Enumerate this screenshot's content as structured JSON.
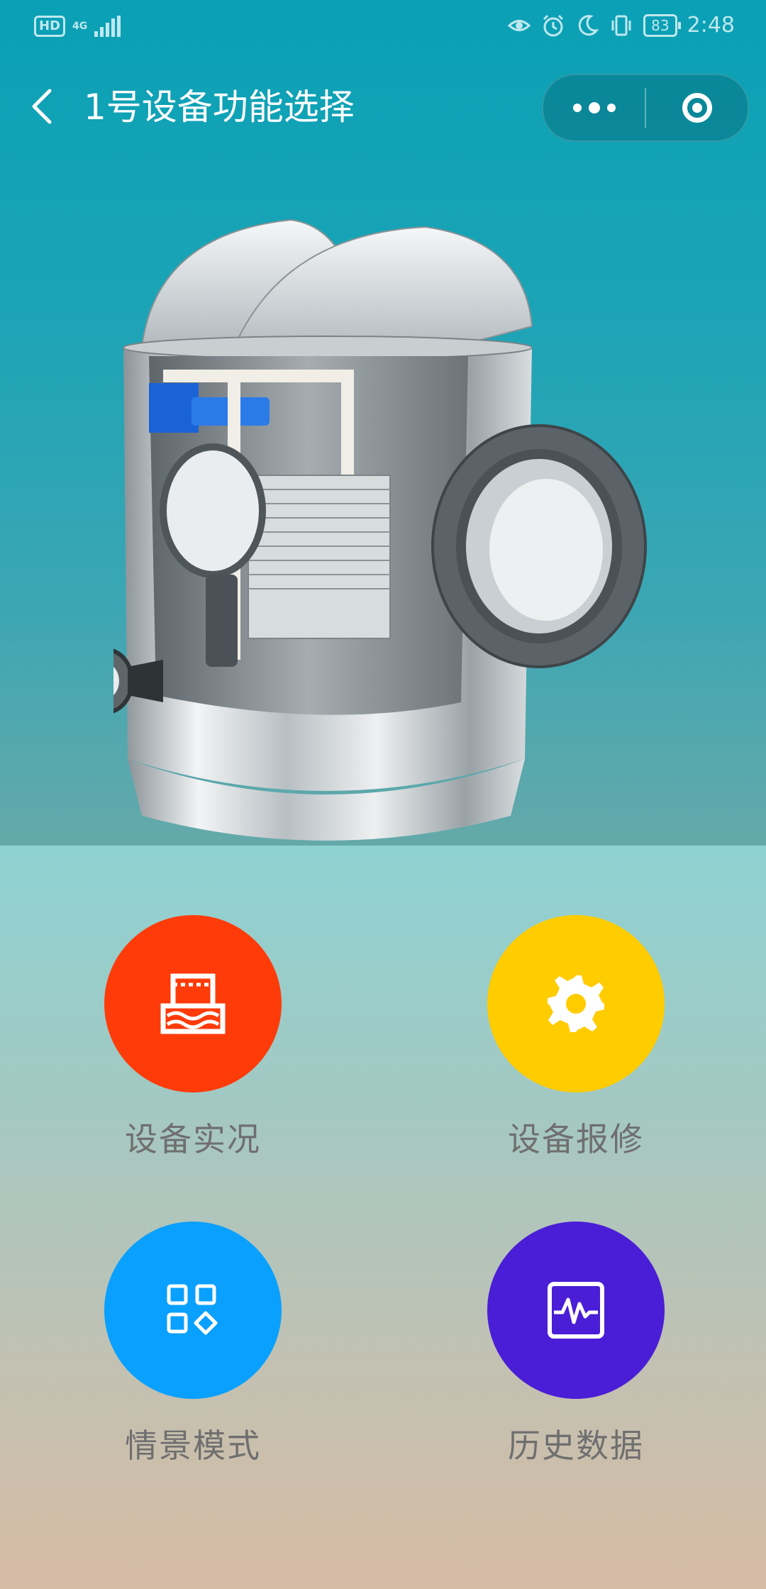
{
  "status_bar": {
    "hd": "HD",
    "network": "4G",
    "battery": "83",
    "time": "2:48",
    "icons": [
      "eye-icon",
      "alarm-icon",
      "moon-icon",
      "vibrate-icon"
    ]
  },
  "header": {
    "title": "1号设备功能选择"
  },
  "colors": {
    "red": "#ff3b0a",
    "yellow": "#ffcc00",
    "blue": "#0aa0ff",
    "purple": "#4a1ed6"
  },
  "functions": [
    {
      "label": "设备实况",
      "icon": "water-gate-icon"
    },
    {
      "label": "设备报修",
      "icon": "gear-icon"
    },
    {
      "label": "情景模式",
      "icon": "grid-icon"
    },
    {
      "label": "历史数据",
      "icon": "waveform-icon"
    }
  ]
}
